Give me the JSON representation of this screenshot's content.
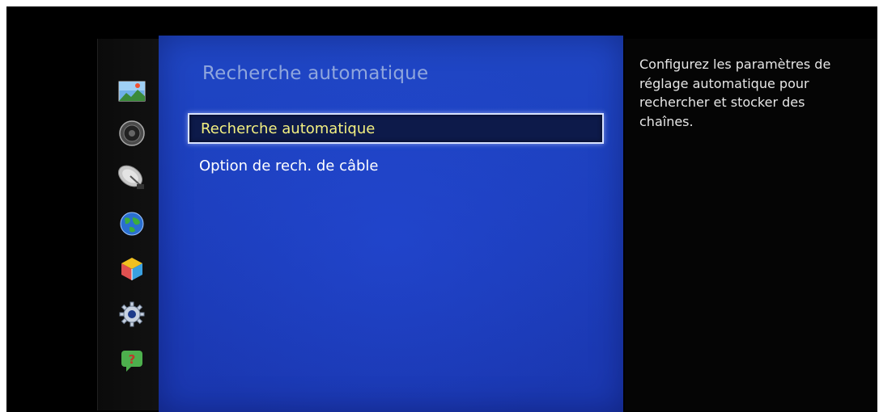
{
  "sidebar": {
    "icons": [
      {
        "name": "picture-icon"
      },
      {
        "name": "sound-icon"
      },
      {
        "name": "satellite-dish-icon"
      },
      {
        "name": "network-globe-icon"
      },
      {
        "name": "smart-hub-cube-icon"
      },
      {
        "name": "settings-gear-icon"
      },
      {
        "name": "help-icon"
      }
    ]
  },
  "menu": {
    "title": "Recherche automatique",
    "items": [
      {
        "label": "Recherche automatique",
        "selected": true
      },
      {
        "label": "Option de rech. de câble",
        "selected": false
      }
    ]
  },
  "help": {
    "text": "Configurez les paramètres de réglage automatique pour rechercher et stocker des chaînes."
  },
  "colors": {
    "panel_blue": "#1d3fbe",
    "selected_text": "#f3f080",
    "title_text": "#8fa6dd"
  }
}
